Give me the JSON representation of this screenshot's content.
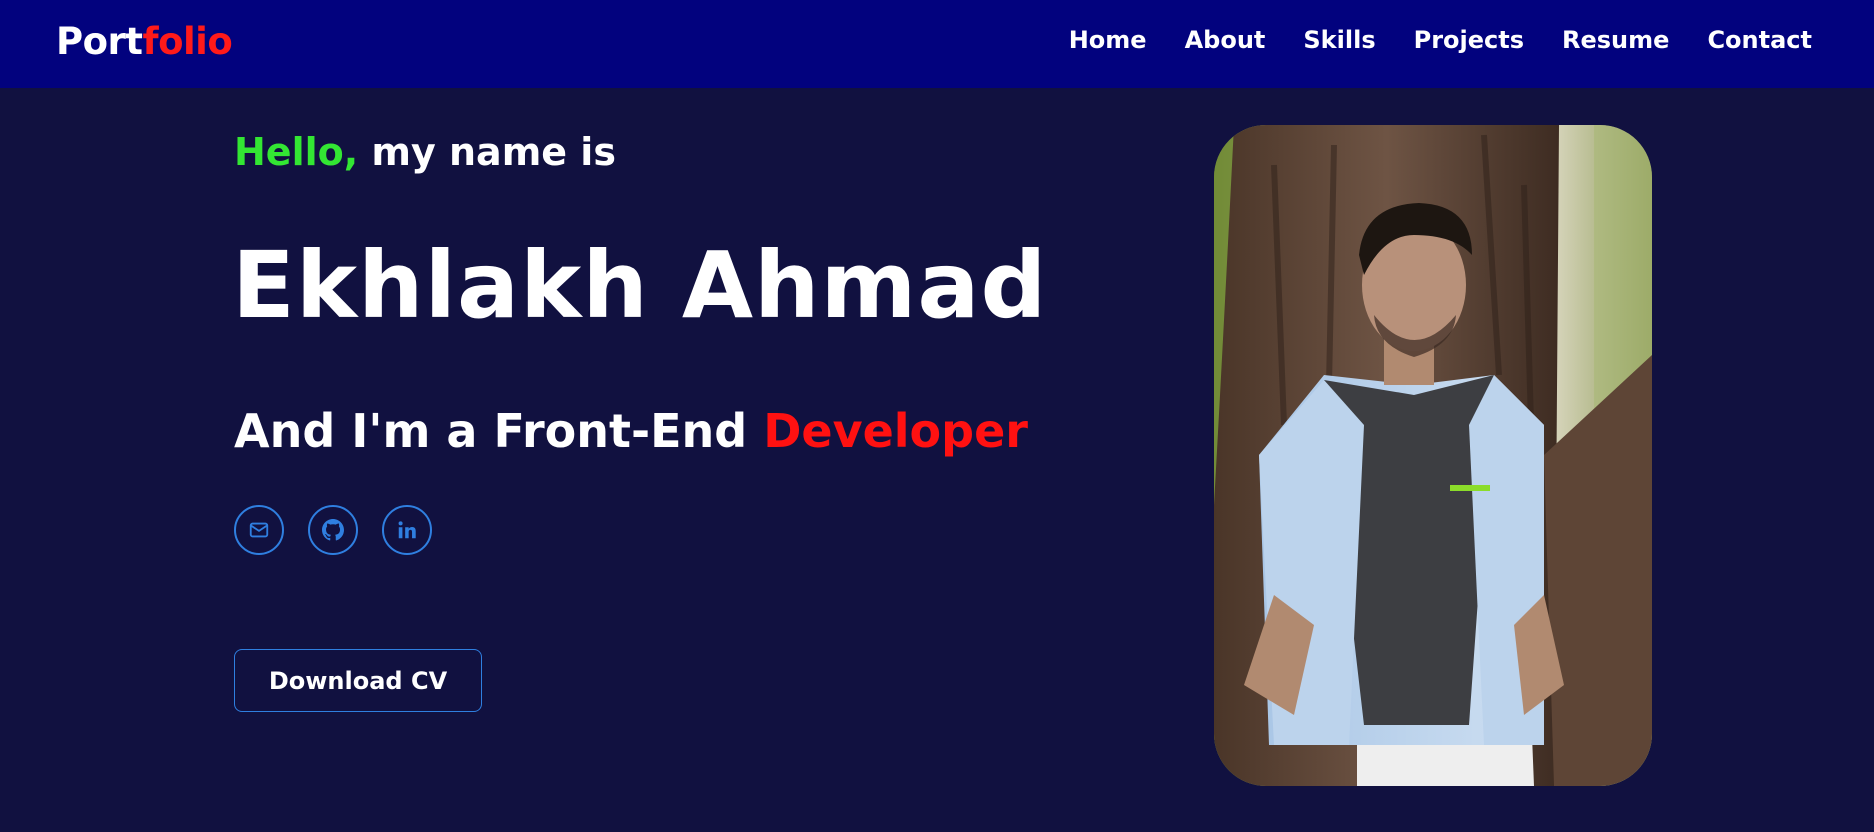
{
  "nav": {
    "logo_part1": "Port",
    "logo_part2": "folio",
    "links": [
      "Home",
      "About",
      "Skills",
      "Projects",
      "Resume",
      "Contact"
    ]
  },
  "hero": {
    "greeting_accent": "Hello,",
    "greeting_rest": " my name is",
    "name": "Ekhlakh Ahmad",
    "role_prefix": "And I'm a Front-End ",
    "role_accent": "Developer",
    "socials": [
      {
        "icon": "mail-icon"
      },
      {
        "icon": "github-icon"
      },
      {
        "icon": "linkedin-icon"
      }
    ],
    "cta_label": "Download CV"
  },
  "colors": {
    "navbar_bg": "#02027e",
    "page_bg": "#111140",
    "green_accent": "#33e633",
    "red_accent": "#ff1111",
    "outline_blue": "#2f7fe0"
  }
}
